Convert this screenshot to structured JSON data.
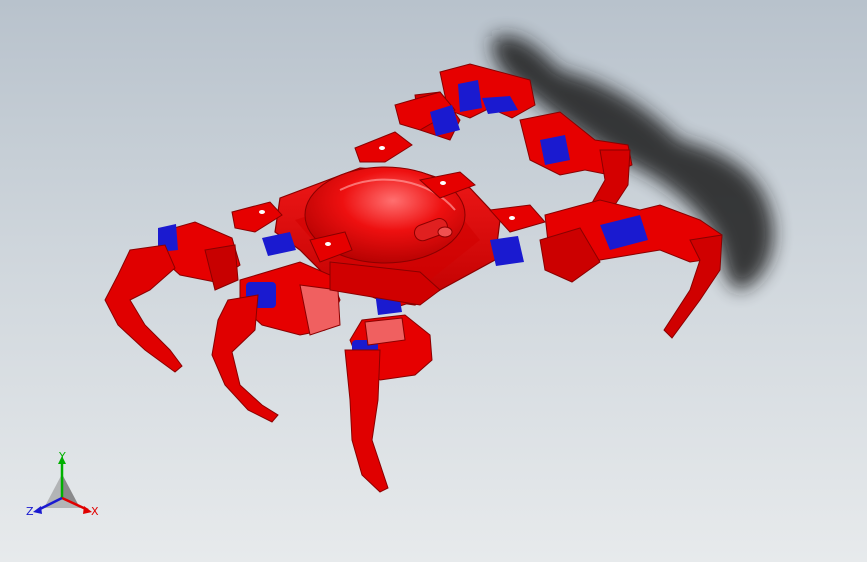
{
  "viewport": {
    "background_top": "#b8c2cc",
    "background_bottom": "#e7eaec"
  },
  "model": {
    "body_color": "#e60000",
    "servo_color": "#1a1ad0",
    "shadow_color": "#1e1e1e"
  },
  "triad": {
    "x_label": "X",
    "y_label": "Y",
    "z_label": "Z",
    "x_color": "#e00000",
    "y_color": "#00b000",
    "z_color": "#1a1ad0"
  }
}
